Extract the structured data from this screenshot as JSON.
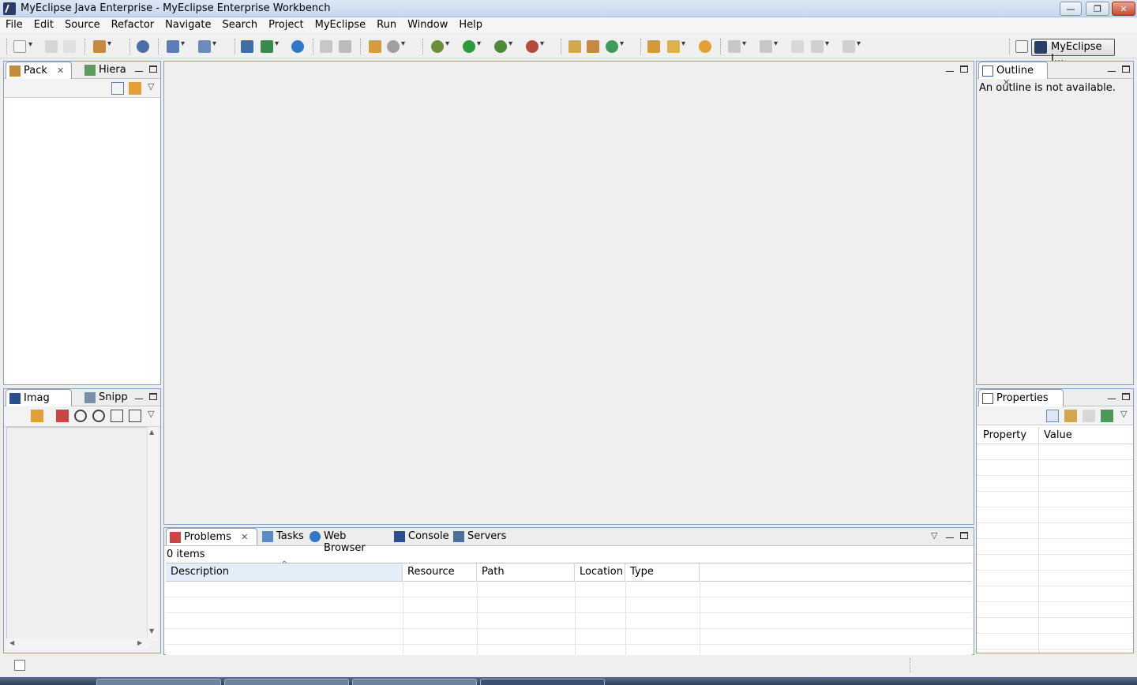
{
  "window": {
    "title": "MyEclipse Java Enterprise - MyEclipse Enterprise Workbench",
    "minimize_label": "—",
    "restore_label": "❐",
    "close_label": "✕"
  },
  "menu": [
    "File",
    "Edit",
    "Source",
    "Refactor",
    "Navigate",
    "Search",
    "Project",
    "MyEclipse",
    "Run",
    "Window",
    "Help"
  ],
  "perspective": {
    "label": "MyEclipse J..."
  },
  "left_top_panel": {
    "tabs": [
      {
        "label": "Pack",
        "close": "✕"
      },
      {
        "label": "Hiera"
      }
    ]
  },
  "left_bottom_panel": {
    "tabs": [
      {
        "label": "Imag",
        "close": "✕"
      },
      {
        "label": "Snipp"
      }
    ],
    "scroll_up": "▲",
    "scroll_down": "▼",
    "scroll_left": "◀",
    "scroll_right": "▶"
  },
  "outline_panel": {
    "tab": "Outline",
    "close": "✕",
    "message": "An outline is not available."
  },
  "properties_panel": {
    "tab": "Properties",
    "close": "✕",
    "columns": [
      "Property",
      "Value"
    ]
  },
  "bottom_panel": {
    "tabs": [
      {
        "label": "Problems",
        "close": "✕"
      },
      {
        "label": "Tasks"
      },
      {
        "label": "Web Browser"
      },
      {
        "label": "Console"
      },
      {
        "label": "Servers"
      }
    ],
    "item_count": "0 items",
    "columns": [
      "Description",
      "Resource",
      "Path",
      "Location",
      "Type"
    ],
    "sort_indicator": "^"
  },
  "controls": {
    "chevron": "▽"
  },
  "colors": {
    "accent_border": "#8b9fb8",
    "title_bar": "#c7d8ee",
    "close_button": "#c74a31"
  }
}
